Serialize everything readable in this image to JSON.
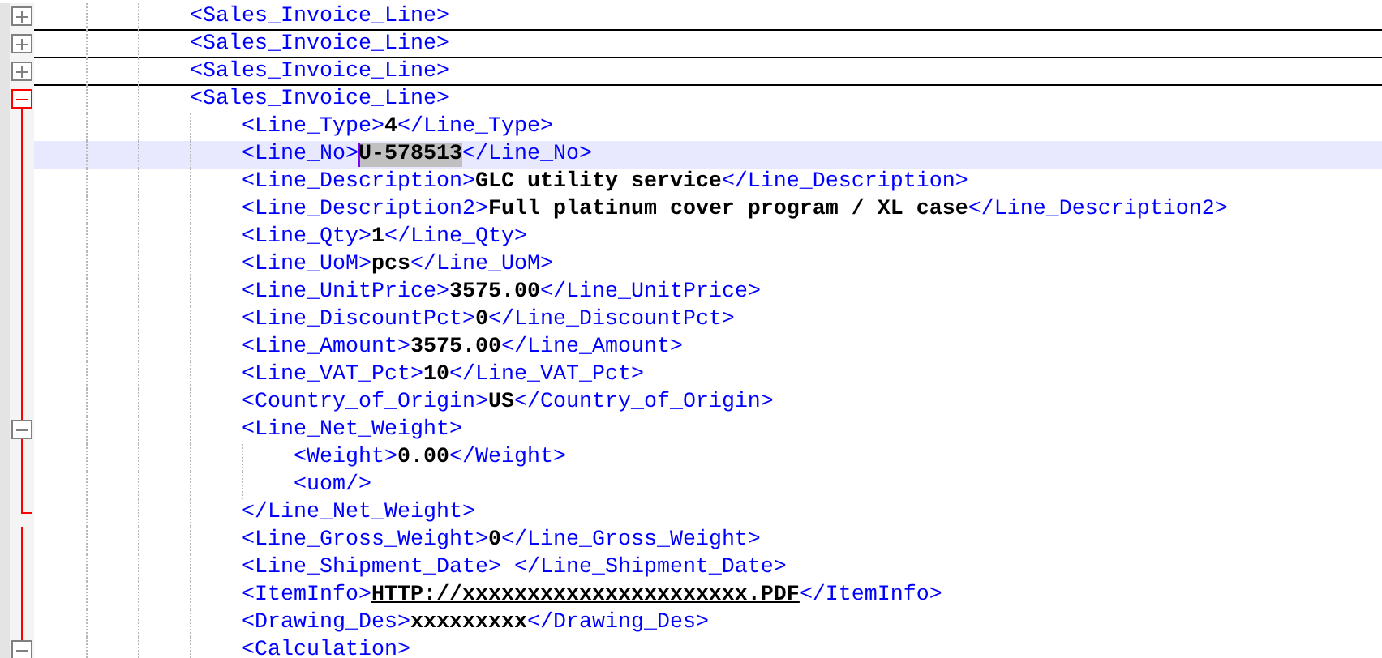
{
  "lines": [
    {
      "segments": [
        {
          "kind": "tag",
          "text": "<Sales_Invoice_Line>"
        }
      ],
      "expanded": false,
      "current": false
    },
    {
      "segments": [
        {
          "kind": "tag",
          "text": "<Sales_Invoice_Line>"
        }
      ],
      "expanded": false,
      "current": false
    },
    {
      "segments": [
        {
          "kind": "tag",
          "text": "<Sales_Invoice_Line>"
        }
      ],
      "expanded": false,
      "current": false
    },
    {
      "segments": [
        {
          "kind": "tag",
          "text": "<Sales_Invoice_Line>"
        }
      ],
      "expanded": true,
      "current": false,
      "children": [
        {
          "segments": [
            {
              "kind": "tag",
              "text": "<Line_Type>"
            },
            {
              "kind": "value",
              "text": "4"
            },
            {
              "kind": "tag",
              "text": "</Line_Type>"
            }
          ],
          "current": false
        },
        {
          "segments": [
            {
              "kind": "tag",
              "text": "<Line_No>"
            },
            {
              "kind": "selection",
              "text": "U-578513"
            },
            {
              "kind": "tag",
              "text": "</Line_No>"
            }
          ],
          "current": true
        },
        {
          "segments": [
            {
              "kind": "tag",
              "text": "<Line_Description>"
            },
            {
              "kind": "value",
              "text": "GLC utility service"
            },
            {
              "kind": "tag",
              "text": "</Line_Description>"
            }
          ],
          "current": false
        },
        {
          "segments": [
            {
              "kind": "tag",
              "text": "<Line_Description2>"
            },
            {
              "kind": "value",
              "text": "Full platinum cover program / XL case"
            },
            {
              "kind": "tag",
              "text": "</Line_Description2>"
            }
          ],
          "current": false
        },
        {
          "segments": [
            {
              "kind": "tag",
              "text": "<Line_Qty>"
            },
            {
              "kind": "value",
              "text": "1"
            },
            {
              "kind": "tag",
              "text": "</Line_Qty>"
            }
          ],
          "current": false
        },
        {
          "segments": [
            {
              "kind": "tag",
              "text": "<Line_UoM>"
            },
            {
              "kind": "value",
              "text": "pcs"
            },
            {
              "kind": "tag",
              "text": "</Line_UoM>"
            }
          ],
          "current": false
        },
        {
          "segments": [
            {
              "kind": "tag",
              "text": "<Line_UnitPrice>"
            },
            {
              "kind": "value",
              "text": "3575.00"
            },
            {
              "kind": "tag",
              "text": "</Line_UnitPrice>"
            }
          ],
          "current": false
        },
        {
          "segments": [
            {
              "kind": "tag",
              "text": "<Line_DiscountPct>"
            },
            {
              "kind": "value",
              "text": "0"
            },
            {
              "kind": "tag",
              "text": "</Line_DiscountPct>"
            }
          ],
          "current": false
        },
        {
          "segments": [
            {
              "kind": "tag",
              "text": "<Line_Amount>"
            },
            {
              "kind": "value",
              "text": "3575.00"
            },
            {
              "kind": "tag",
              "text": "</Line_Amount>"
            }
          ],
          "current": false
        },
        {
          "segments": [
            {
              "kind": "tag",
              "text": "<Line_VAT_Pct>"
            },
            {
              "kind": "value",
              "text": "10"
            },
            {
              "kind": "tag",
              "text": "</Line_VAT_Pct>"
            }
          ],
          "current": false
        },
        {
          "segments": [
            {
              "kind": "tag",
              "text": "<Country_of_Origin>"
            },
            {
              "kind": "value",
              "text": "US"
            },
            {
              "kind": "tag",
              "text": "</Country_of_Origin>"
            }
          ],
          "current": false
        },
        {
          "segments": [
            {
              "kind": "tag",
              "text": "<Line_Net_Weight>"
            }
          ],
          "expanded": true,
          "current": false,
          "children": [
            {
              "segments": [
                {
                  "kind": "tag",
                  "text": "<Weight>"
                },
                {
                  "kind": "value",
                  "text": "0.00"
                },
                {
                  "kind": "tag",
                  "text": "</Weight>"
                }
              ],
              "current": false
            },
            {
              "segments": [
                {
                  "kind": "tag",
                  "text": "<uom/>"
                }
              ],
              "current": false
            }
          ],
          "close": [
            {
              "kind": "tag",
              "text": "</Line_Net_Weight>"
            }
          ]
        },
        {
          "segments": [
            {
              "kind": "tag",
              "text": "<Line_Gross_Weight>"
            },
            {
              "kind": "value",
              "text": "0"
            },
            {
              "kind": "tag",
              "text": "</Line_Gross_Weight>"
            }
          ],
          "current": false
        },
        {
          "segments": [
            {
              "kind": "tag",
              "text": "<Line_Shipment_Date> </Line_Shipment_Date>"
            }
          ],
          "current": false
        },
        {
          "segments": [
            {
              "kind": "tag",
              "text": "<ItemInfo>"
            },
            {
              "kind": "link",
              "text": "HTTP://xxxxxxxxxxxxxxxxxxxxxx.PDF"
            },
            {
              "kind": "tag",
              "text": "</ItemInfo>"
            }
          ],
          "current": false
        },
        {
          "segments": [
            {
              "kind": "tag",
              "text": "<Drawing_Des>"
            },
            {
              "kind": "value",
              "text": "xxxxxxxxx"
            },
            {
              "kind": "tag",
              "text": "</Drawing_Des>"
            }
          ],
          "current": false
        },
        {
          "segments": [
            {
              "kind": "tag",
              "text": "<Calculation>"
            }
          ],
          "expanded": true,
          "current": false
        }
      ]
    }
  ]
}
